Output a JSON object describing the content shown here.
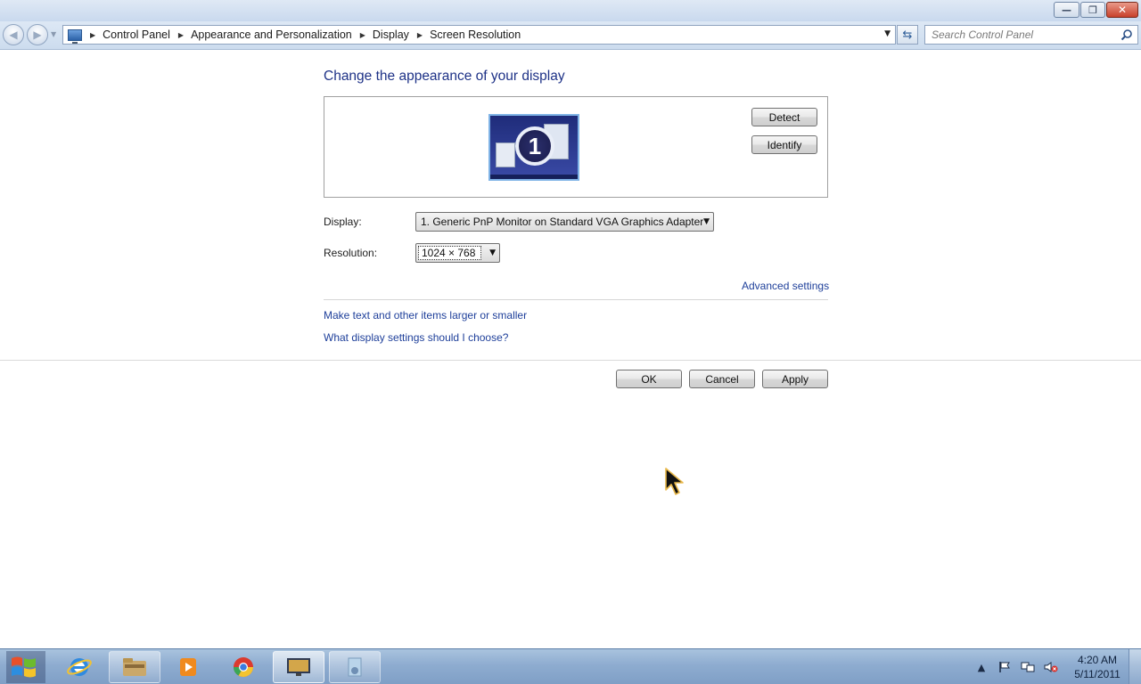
{
  "window": {
    "controls": {
      "minimize": "—",
      "maximize": "❐",
      "close": "✕"
    }
  },
  "navigation": {
    "back_glyph": "◀",
    "forward_glyph": "▶",
    "breadcrumbs": [
      "Control Panel",
      "Appearance and Personalization",
      "Display",
      "Screen Resolution"
    ],
    "refresh_glyph": "⇆",
    "search": {
      "placeholder": "Search Control Panel",
      "value": ""
    }
  },
  "main": {
    "title": "Change the appearance of your display",
    "monitor_number": "1",
    "detect_label": "Detect",
    "identify_label": "Identify",
    "display_label": "Display:",
    "display_value": "1. Generic PnP Monitor on Standard VGA Graphics Adapter",
    "resolution_label": "Resolution:",
    "resolution_value": "1024 × 768",
    "advanced_link": "Advanced settings",
    "larger_link": "Make text and other items larger or smaller",
    "choose_link": "What display settings should I choose?"
  },
  "footer": {
    "ok_label": "OK",
    "cancel_label": "Cancel",
    "apply_label": "Apply"
  },
  "taskbar": {
    "items": [
      {
        "name": "internet-explorer",
        "state": "plain"
      },
      {
        "name": "file-explorer",
        "state": "pinned"
      },
      {
        "name": "media-player",
        "state": "plain"
      },
      {
        "name": "chrome",
        "state": "plain"
      },
      {
        "name": "display-control-panel",
        "state": "active"
      },
      {
        "name": "media-center",
        "state": "pinned"
      }
    ],
    "clock_time": "4:20 AM",
    "clock_date": "5/11/2011"
  },
  "colors": {
    "title_blue": "#1e3287",
    "link_blue": "#1e3f9a",
    "taskbar": "#8eacd0"
  }
}
